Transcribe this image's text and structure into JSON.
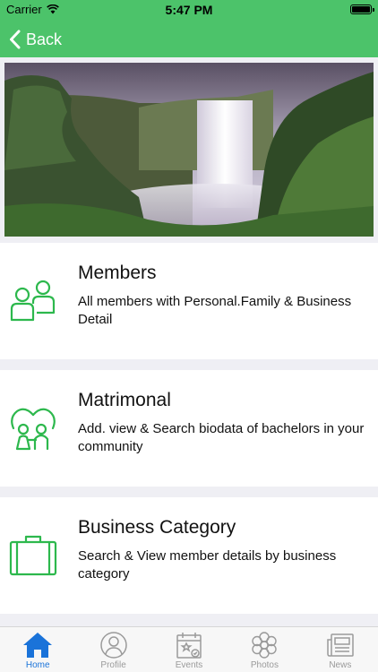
{
  "status_bar": {
    "carrier": "Carrier",
    "time": "5:47 PM"
  },
  "nav": {
    "back_label": "Back"
  },
  "cards": [
    {
      "title": "Members",
      "description": "All members with Personal.Family & Business Detail",
      "icon": "members-icon"
    },
    {
      "title": "Matrimonal",
      "description": "Add. view & Search biodata of bachelors in your community",
      "icon": "matrimonial-heart-icon"
    },
    {
      "title": "Business Category",
      "description": "Search & View member details by business category",
      "icon": "briefcase-icon"
    }
  ],
  "tabs": [
    {
      "label": "Home",
      "icon": "home-icon",
      "active": true
    },
    {
      "label": "Profile",
      "icon": "profile-icon",
      "active": false
    },
    {
      "label": "Events",
      "icon": "events-calendar-icon",
      "active": false
    },
    {
      "label": "Photos",
      "icon": "photos-flower-icon",
      "active": false
    },
    {
      "label": "News",
      "icon": "news-icon",
      "active": false
    }
  ],
  "colors": {
    "accent_green": "#4cc36a",
    "icon_green": "#2db84d",
    "active_tab_blue": "#1a73d9",
    "inactive_tab_gray": "#9a9a9a"
  }
}
